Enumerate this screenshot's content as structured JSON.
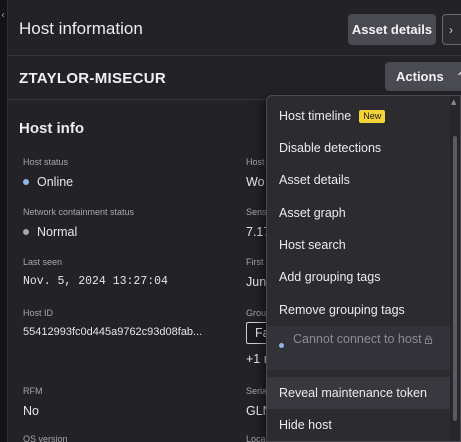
{
  "header": {
    "title": "Host information",
    "asset_details_label": "Asset details",
    "collapse_glyph": "›"
  },
  "host": {
    "hostname": "ZTAYLOR-MISECUR",
    "actions_label": "Actions"
  },
  "host_info": {
    "section_title": "Host info",
    "left_fields": [
      {
        "label": "Host status",
        "value": "Online",
        "dot_color": "#8fb6ea"
      },
      {
        "label": "Network containment status",
        "value": "Normal",
        "dot_color": "#a6a6ae"
      },
      {
        "label": "Last seen",
        "value": "Nov. 5, 2024 13:27:04"
      },
      {
        "label": "Host ID",
        "value": "55412993fc0d445a9762c93d08fab..."
      },
      {
        "label": "RFM",
        "value": "No"
      },
      {
        "label": "OS version",
        "value": ""
      }
    ],
    "right_fields": [
      {
        "label": "Host",
        "value": "Wo"
      },
      {
        "label": "Sens",
        "value": "7.17"
      },
      {
        "label": "First",
        "value": "Jun"
      },
      {
        "label": "Grou",
        "value": "Fa",
        "more": "+1 n"
      },
      {
        "label": "Seria",
        "value": "GLN"
      },
      {
        "label": "Loca",
        "value": ""
      }
    ]
  },
  "actions_menu": {
    "items": [
      {
        "label": "Host timeline",
        "badge": "New"
      },
      {
        "label": "Disable detections"
      },
      {
        "label": "Asset details"
      },
      {
        "label": "Asset graph"
      },
      {
        "label": "Host search"
      },
      {
        "label": "Add grouping tags"
      },
      {
        "label": "Remove grouping tags"
      },
      {
        "label": "Cannot connect to host",
        "disabled": true
      },
      {
        "label": "Reveal maintenance token"
      },
      {
        "label": "Hide host"
      }
    ]
  },
  "colors": {
    "background": "#1f1f23",
    "button": "#4a4a52",
    "badge_new": "#f4d23a",
    "online_dot": "#8fb6ea"
  }
}
